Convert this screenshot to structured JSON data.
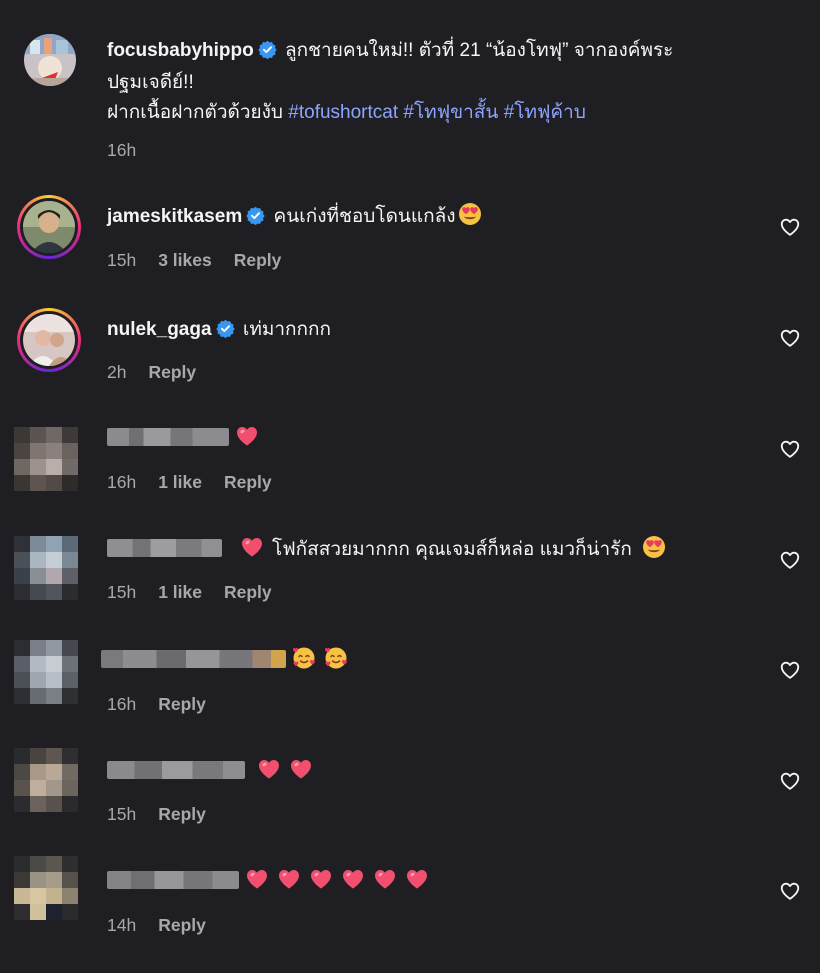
{
  "post": {
    "username": "focusbabyhippo",
    "caption_line1": "ลูกชายคนใหม่!! ตัวที่ 21 “น้องโทฟุ” จากองค์พระ",
    "caption_line2": "ปฐมเจดีย์!!",
    "caption_line3_text": "ฝากเนื้อฝากตัวด้วยงับ",
    "hashtags": [
      "#tofushortcat",
      "#โทฟุขาสั้น",
      "#โทฟุค้าบ"
    ],
    "time": "16h"
  },
  "comments": [
    {
      "username": "jameskitkasem",
      "verified": true,
      "text": "คนเก่งที่ชอบโดนแกล้ง",
      "emojis": [
        "heart-eyes-emoji"
      ],
      "time": "15h",
      "likes": "3 likes",
      "reply": "Reply"
    },
    {
      "username": "nulek_gaga",
      "verified": true,
      "text": "เท่มากกกก",
      "emojis": [],
      "time": "2h",
      "likes": "",
      "reply": "Reply"
    },
    {
      "username": "",
      "text": "",
      "emojis": [
        "heart-emoji"
      ],
      "time": "16h",
      "likes": "1 like",
      "reply": "Reply"
    },
    {
      "username": "",
      "text": "โฟกัสสวยมากกก คุณเจมส์ก็หล่อ แมวก็น่ารัก",
      "emojis": [
        "heart-emoji",
        "heart-eyes-emoji"
      ],
      "time": "15h",
      "likes": "1 like",
      "reply": "Reply"
    },
    {
      "username": "",
      "text": "",
      "emojis": [
        "smiling-hearts-emoji",
        "smiling-hearts-emoji"
      ],
      "time": "16h",
      "likes": "",
      "reply": "Reply"
    },
    {
      "username": "",
      "text": "",
      "emojis": [
        "heart-emoji",
        "heart-emoji"
      ],
      "time": "15h",
      "likes": "",
      "reply": "Reply"
    },
    {
      "username": "",
      "text": "",
      "emojis": [
        "heart-emoji",
        "heart-emoji",
        "heart-emoji",
        "heart-emoji",
        "heart-emoji",
        "heart-emoji"
      ],
      "time": "14h",
      "likes": "",
      "reply": "Reply"
    }
  ],
  "colors": {
    "background": "#1f1f23",
    "hashtag": "#8da4ff",
    "verified": "#3897f0",
    "meta": "#a8a8a8",
    "heart_emoji": "#f0506e"
  }
}
